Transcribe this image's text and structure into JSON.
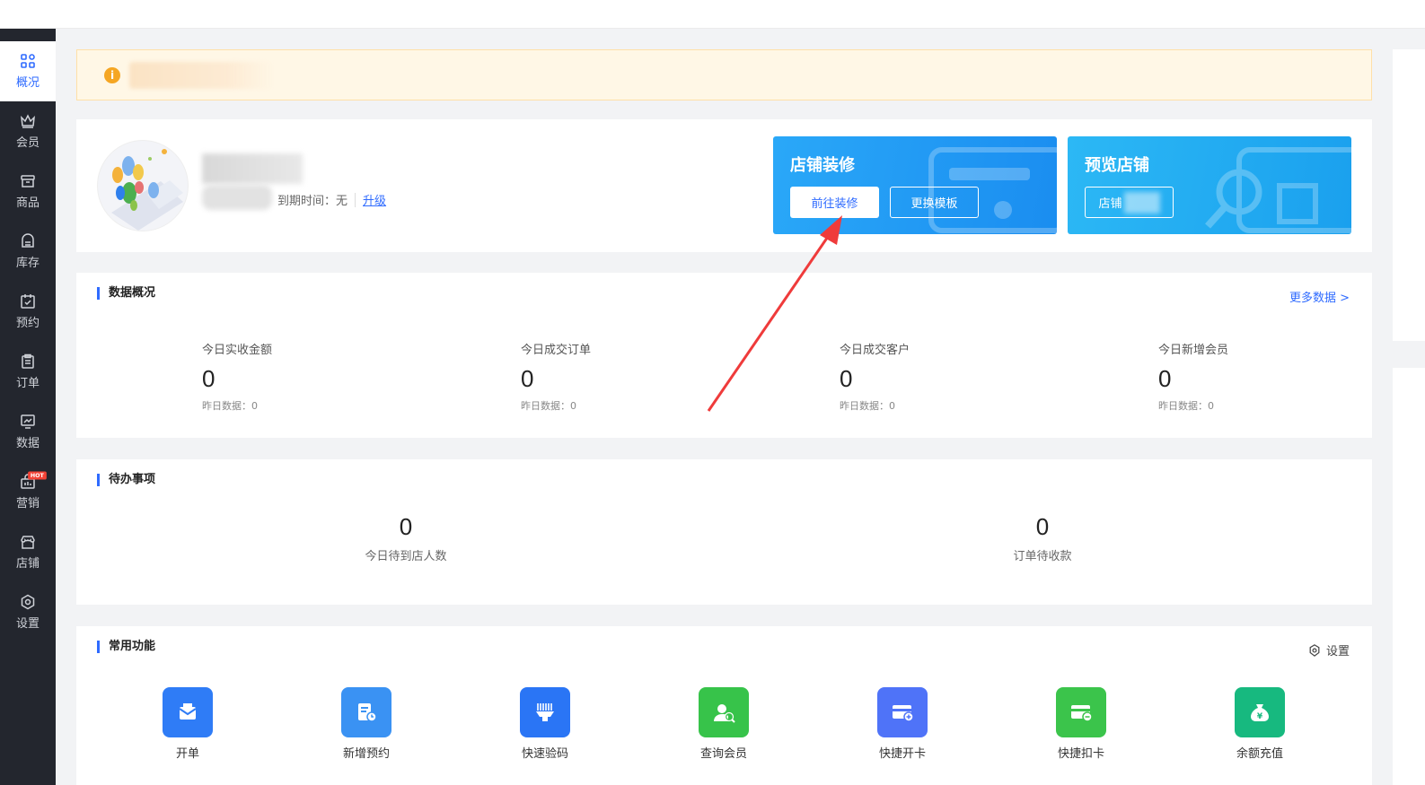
{
  "sidebar": {
    "items": [
      {
        "label": "概况",
        "icon": "grid-icon",
        "active": true
      },
      {
        "label": "会员",
        "icon": "crown-icon"
      },
      {
        "label": "商品",
        "icon": "box-icon"
      },
      {
        "label": "库存",
        "icon": "inventory-icon"
      },
      {
        "label": "预约",
        "icon": "calendar-check-icon"
      },
      {
        "label": "订单",
        "icon": "clipboard-icon"
      },
      {
        "label": "数据",
        "icon": "chart-board-icon"
      },
      {
        "label": "营销",
        "icon": "gift-bag-icon",
        "badge": "HOT"
      },
      {
        "label": "店铺",
        "icon": "store-icon"
      },
      {
        "label": "设置",
        "icon": "settings-icon"
      }
    ]
  },
  "notice": {
    "icon": "info-icon",
    "icon_glyph": "i"
  },
  "shop": {
    "expire_label": "到期时间：无",
    "upgrade_label": "升级"
  },
  "promos": {
    "decorate": {
      "title": "店铺装修",
      "btn_primary": "前往装修",
      "btn_secondary": "更换模板"
    },
    "preview": {
      "title": "预览店铺",
      "btn": "店铺"
    }
  },
  "data_overview": {
    "title": "数据概况",
    "more": "更多数据 >",
    "stats": [
      {
        "label": "今日实收金额",
        "value": "0",
        "sub": "昨日数据：0"
      },
      {
        "label": "今日成交订单",
        "value": "0",
        "sub": "昨日数据：0"
      },
      {
        "label": "今日成交客户",
        "value": "0",
        "sub": "昨日数据：0"
      },
      {
        "label": "今日新增会员",
        "value": "0",
        "sub": "昨日数据：0"
      }
    ]
  },
  "todo": {
    "title": "待办事项",
    "items": [
      {
        "value": "0",
        "label": "今日待到店人数"
      },
      {
        "value": "0",
        "label": "订单待收款"
      }
    ]
  },
  "functions": {
    "title": "常用功能",
    "settings": "设置",
    "items": [
      {
        "label": "开单",
        "color": "#2f7cf6",
        "icon": "mail-icon"
      },
      {
        "label": "新增预约",
        "color": "#3a92f3",
        "icon": "appointment-icon"
      },
      {
        "label": "快速验码",
        "color": "#2a75f5",
        "icon": "barcode-icon"
      },
      {
        "label": "查询会员",
        "color": "#37c34a",
        "icon": "member-search-icon"
      },
      {
        "label": "快捷开卡",
        "color": "#4f73f8",
        "icon": "card-add-icon"
      },
      {
        "label": "快捷扣卡",
        "color": "#3bc44b",
        "icon": "card-minus-icon"
      },
      {
        "label": "余额充值",
        "color": "#17b97f",
        "icon": "money-bag-icon"
      }
    ]
  },
  "colors": {
    "accent": "#2f6bff",
    "sidebar": "#23262e",
    "arrow": "#ef3b3b"
  }
}
